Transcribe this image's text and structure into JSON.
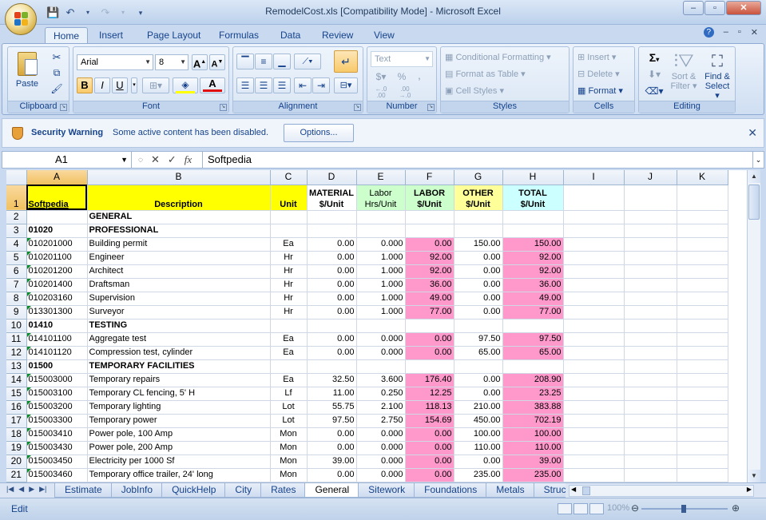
{
  "window": {
    "title": "RemodelCost.xls  [Compatibility Mode] - Microsoft Excel",
    "controls": [
      "–",
      "▫",
      "✕"
    ]
  },
  "qat": {
    "icons": [
      "save-icon",
      "undo-icon",
      "redo-icon",
      "customize-icon"
    ]
  },
  "ribbon": {
    "tabs": [
      "Home",
      "Insert",
      "Page Layout",
      "Formulas",
      "Data",
      "Review",
      "View"
    ],
    "active_tab": "Home",
    "clipboard": {
      "label": "Clipboard",
      "paste": "Paste"
    },
    "font": {
      "label": "Font",
      "family": "Arial",
      "size": "8",
      "bold": "B",
      "italic": "I",
      "underline": "U"
    },
    "alignment": {
      "label": "Alignment"
    },
    "number": {
      "label": "Number",
      "format": "Text",
      "currency": "$",
      "percent": "%",
      "comma": ","
    },
    "styles": {
      "label": "Styles",
      "conditional": "Conditional Formatting",
      "format_table": "Format as Table",
      "cell_styles": "Cell Styles"
    },
    "cells": {
      "label": "Cells",
      "insert": "Insert",
      "delete": "Delete",
      "format": "Format"
    },
    "editing": {
      "label": "Editing",
      "sum": "Σ",
      "sort": "Sort &",
      "filter": "Filter",
      "find": "Find &",
      "select": "Select"
    }
  },
  "security": {
    "title": "Security Warning",
    "message": "Some active content has been disabled.",
    "button": "Options..."
  },
  "formula_bar": {
    "name_box": "A1",
    "fx": "fx",
    "content": "Softpedia"
  },
  "sheet": {
    "columns": [
      "A",
      "B",
      "C",
      "D",
      "E",
      "F",
      "G",
      "H",
      "I",
      "J",
      "K"
    ],
    "header": {
      "a": "Softpedia",
      "b": "Description",
      "c": "Unit",
      "d1": "MATERIAL",
      "d2": "$/Unit",
      "e1": "Labor",
      "e2": "Hrs/Unit",
      "f1": "LABOR",
      "f2": "$/Unit",
      "g1": "OTHER",
      "g2": "$/Unit",
      "h1": "TOTAL",
      "h2": "$/Unit"
    },
    "rows": [
      {
        "n": "2",
        "a": "",
        "b": "GENERAL",
        "c": "",
        "d": "",
        "e": "",
        "f": "",
        "g": "",
        "h": "",
        "bold": true
      },
      {
        "n": "3",
        "a": "01020",
        "b": "PROFESSIONAL",
        "c": "",
        "d": "",
        "e": "",
        "f": "",
        "g": "",
        "h": "",
        "bold": true
      },
      {
        "n": "4",
        "a": "010201000",
        "b": "Building permit",
        "c": "Ea",
        "d": "0.00",
        "e": "0.000",
        "f": "0.00",
        "g": "150.00",
        "h": "150.00"
      },
      {
        "n": "5",
        "a": "010201100",
        "b": "Engineer",
        "c": "Hr",
        "d": "0.00",
        "e": "1.000",
        "f": "92.00",
        "g": "0.00",
        "h": "92.00"
      },
      {
        "n": "6",
        "a": "010201200",
        "b": "Architect",
        "c": "Hr",
        "d": "0.00",
        "e": "1.000",
        "f": "92.00",
        "g": "0.00",
        "h": "92.00"
      },
      {
        "n": "7",
        "a": "010201400",
        "b": "Draftsman",
        "c": "Hr",
        "d": "0.00",
        "e": "1.000",
        "f": "36.00",
        "g": "0.00",
        "h": "36.00"
      },
      {
        "n": "8",
        "a": "010203160",
        "b": "Supervision",
        "c": "Hr",
        "d": "0.00",
        "e": "1.000",
        "f": "49.00",
        "g": "0.00",
        "h": "49.00"
      },
      {
        "n": "9",
        "a": "013301300",
        "b": "Surveyor",
        "c": "Hr",
        "d": "0.00",
        "e": "1.000",
        "f": "77.00",
        "g": "0.00",
        "h": "77.00"
      },
      {
        "n": "10",
        "a": "01410",
        "b": "TESTING",
        "c": "",
        "d": "",
        "e": "",
        "f": "",
        "g": "",
        "h": "",
        "bold": true
      },
      {
        "n": "11",
        "a": "014101100",
        "b": "Aggregate test",
        "c": "Ea",
        "d": "0.00",
        "e": "0.000",
        "f": "0.00",
        "g": "97.50",
        "h": "97.50"
      },
      {
        "n": "12",
        "a": "014101120",
        "b": "Compression test, cylinder",
        "c": "Ea",
        "d": "0.00",
        "e": "0.000",
        "f": "0.00",
        "g": "65.00",
        "h": "65.00"
      },
      {
        "n": "13",
        "a": "01500",
        "b": "TEMPORARY FACILITIES",
        "c": "",
        "d": "",
        "e": "",
        "f": "",
        "g": "",
        "h": "",
        "bold": true
      },
      {
        "n": "14",
        "a": "015003000",
        "b": "Temporary repairs",
        "c": "Ea",
        "d": "32.50",
        "e": "3.600",
        "f": "176.40",
        "g": "0.00",
        "h": "208.90"
      },
      {
        "n": "15",
        "a": "015003100",
        "b": "Temporary CL fencing, 5' H",
        "c": "Lf",
        "d": "11.00",
        "e": "0.250",
        "f": "12.25",
        "g": "0.00",
        "h": "23.25"
      },
      {
        "n": "16",
        "a": "015003200",
        "b": "Temporary lighting",
        "c": "Lot",
        "d": "55.75",
        "e": "2.100",
        "f": "118.13",
        "g": "210.00",
        "h": "383.88"
      },
      {
        "n": "17",
        "a": "015003300",
        "b": "Temporary power",
        "c": "Lot",
        "d": "97.50",
        "e": "2.750",
        "f": "154.69",
        "g": "450.00",
        "h": "702.19"
      },
      {
        "n": "18",
        "a": "015003410",
        "b": "Power pole, 100 Amp",
        "c": "Mon",
        "d": "0.00",
        "e": "0.000",
        "f": "0.00",
        "g": "100.00",
        "h": "100.00"
      },
      {
        "n": "19",
        "a": "015003430",
        "b": "Power pole, 200 Amp",
        "c": "Mon",
        "d": "0.00",
        "e": "0.000",
        "f": "0.00",
        "g": "110.00",
        "h": "110.00"
      },
      {
        "n": "20",
        "a": "015003450",
        "b": "Electricity per 1000 Sf",
        "c": "Mon",
        "d": "39.00",
        "e": "0.000",
        "f": "0.00",
        "g": "0.00",
        "h": "39.00"
      },
      {
        "n": "21",
        "a": "015003460",
        "b": "Temporary office trailer, 24' long",
        "c": "Mon",
        "d": "0.00",
        "e": "0.000",
        "f": "0.00",
        "g": "235.00",
        "h": "235.00"
      }
    ]
  },
  "sheet_tabs": [
    "Estimate",
    "JobInfo",
    "QuickHelp",
    "City",
    "Rates",
    "General",
    "Sitework",
    "Foundations",
    "Metals",
    "Structur"
  ],
  "active_sheet": "General",
  "status": {
    "mode": "Edit",
    "zoom": "100%"
  }
}
